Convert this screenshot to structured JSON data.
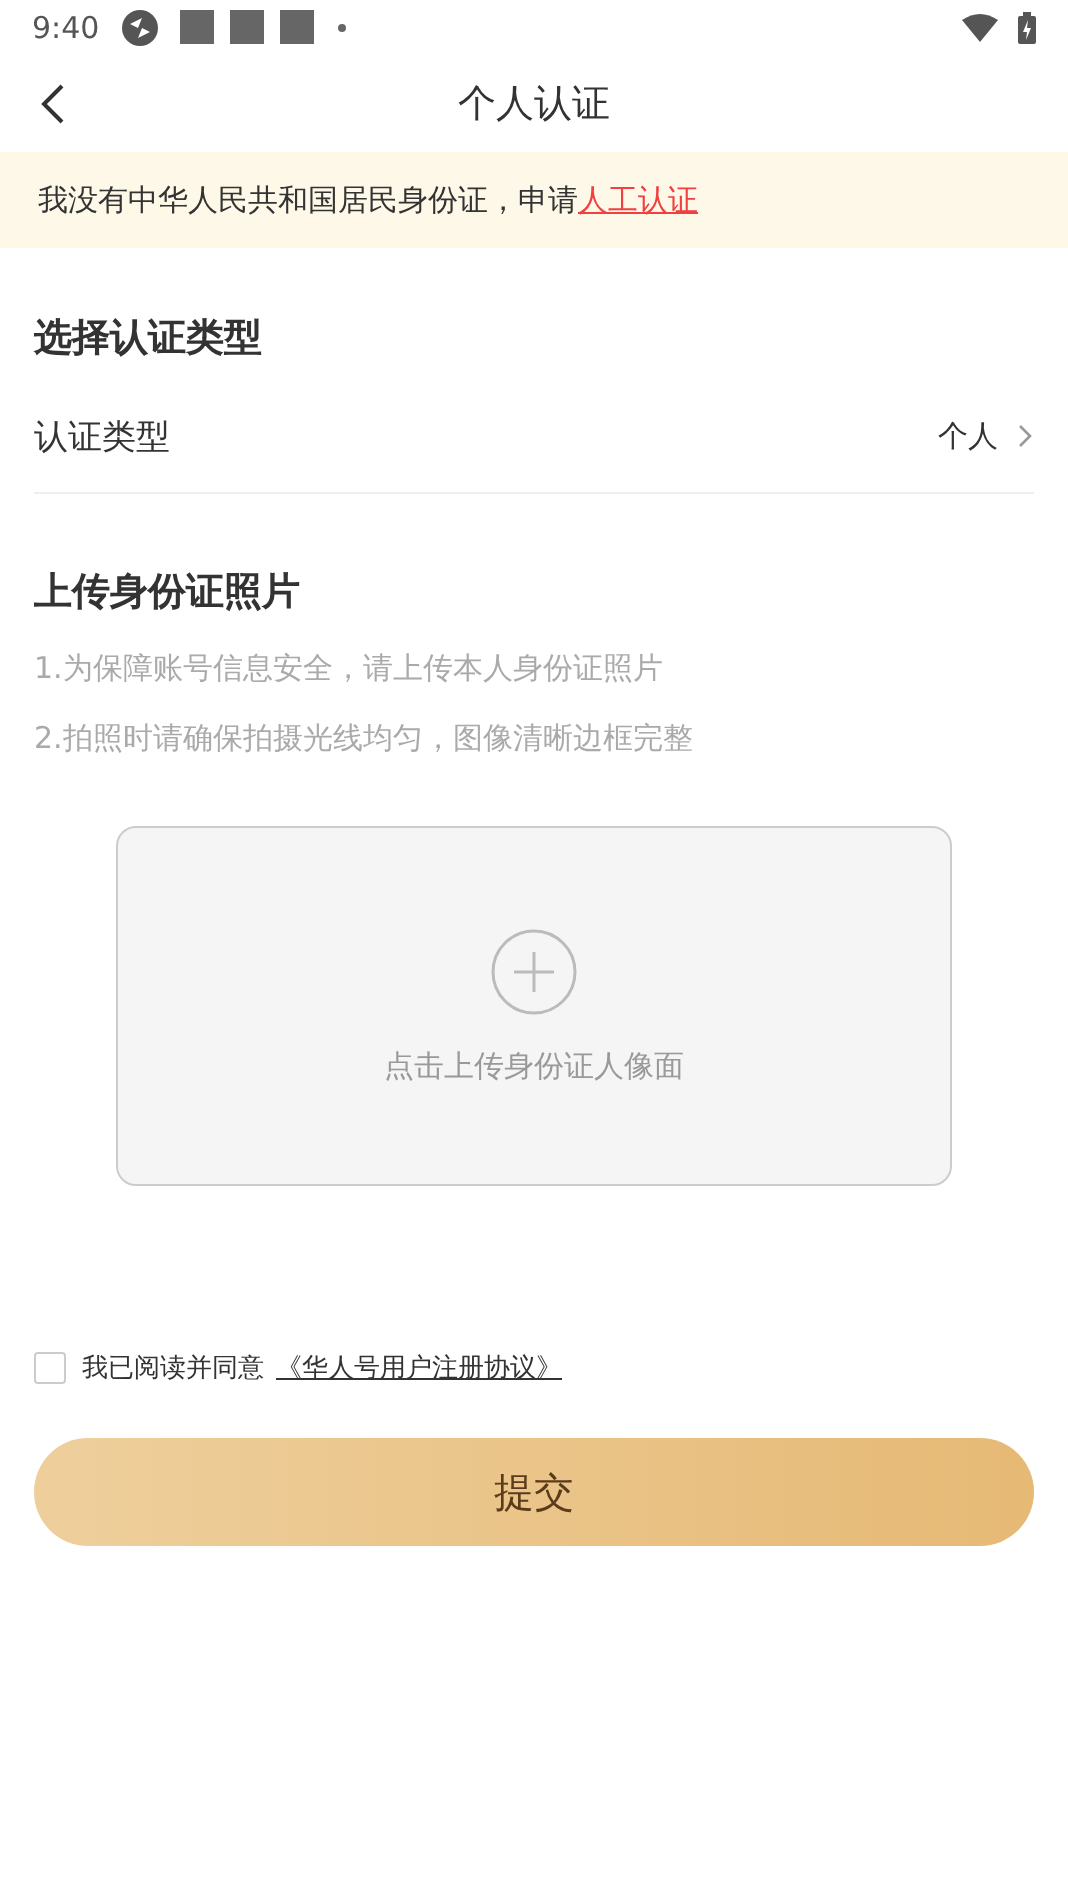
{
  "status_bar": {
    "time": "9:40"
  },
  "header": {
    "title": "个人认证"
  },
  "notice": {
    "text": "我没有中华人民共和国居民身份证，申请",
    "link": "人工认证"
  },
  "type_section": {
    "heading": "选择认证类型",
    "row": {
      "label": "认证类型",
      "value": "个人"
    }
  },
  "upload_section": {
    "heading": "上传身份证照片",
    "tips": [
      "1.为保障账号信息安全，请上传本人身份证照片",
      "2.拍照时请确保拍摄光线均匀，图像清晰边框完整"
    ],
    "upload_box": {
      "label": "点击上传身份证人像面"
    }
  },
  "agreement": {
    "checked": false,
    "text": "我已阅读并同意",
    "link": "《华人号用户注册协议》"
  },
  "submit_button": "提交"
}
